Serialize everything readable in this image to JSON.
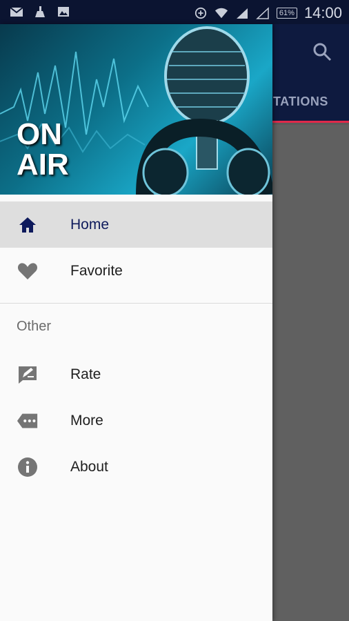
{
  "status_bar": {
    "time": "14:00",
    "battery": "61%",
    "icons": [
      "mail-icon",
      "cleaner-icon",
      "image-icon",
      "data-saver-icon",
      "wifi-icon",
      "signal-icon",
      "signal-no-sim-icon"
    ]
  },
  "app": {
    "tab_label": "TATIONS",
    "search_icon": "search-icon"
  },
  "drawer": {
    "header_text_line1": "ON",
    "header_text_line2": "AIR",
    "main_items": [
      {
        "label": "Home",
        "icon": "home-icon",
        "active": true
      },
      {
        "label": "Favorite",
        "icon": "heart-icon",
        "active": false
      }
    ],
    "section_title": "Other",
    "other_items": [
      {
        "label": "Rate",
        "icon": "rate-feedback-icon"
      },
      {
        "label": "More",
        "icon": "more-tag-icon"
      },
      {
        "label": "About",
        "icon": "info-icon"
      }
    ]
  },
  "colors": {
    "appbar": "#0e1a3f",
    "accent": "#e0294a",
    "active_item_bg": "#dedede",
    "active_text": "#0e1a5c"
  }
}
